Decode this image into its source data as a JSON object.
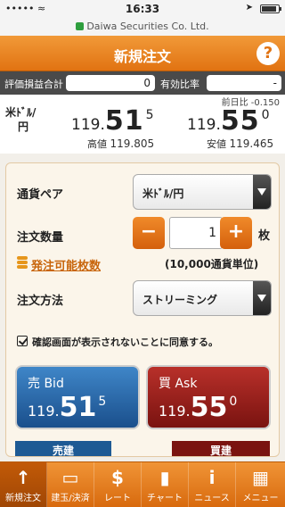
{
  "status": {
    "time": "16:33",
    "signal": "••••• ≈"
  },
  "url": {
    "text": "Daiwa Securities Co. Ltd."
  },
  "header": {
    "title": "新規注文",
    "help": "?"
  },
  "summary": {
    "pl_label": "評価損益合計",
    "pl_value": "0",
    "ratio_label": "有効比率",
    "ratio_value": "-"
  },
  "quote": {
    "pair_line1": "米ﾄﾞﾙ/",
    "pair_line2": "円",
    "cmp": "前日比 -0.150",
    "bid": {
      "pre": "119.",
      "big": "51",
      "pip": "5"
    },
    "ask": {
      "pre": "119.",
      "big": "55",
      "pip": "0"
    },
    "high_label": "高値",
    "high_value": "119.805",
    "low_label": "安値",
    "low_value": "119.465"
  },
  "form": {
    "pair_label": "通貨ペア",
    "pair_value": "米ﾄﾞﾙ/円",
    "qty_label": "注文数量",
    "qty_minus": "−",
    "qty_value": "1",
    "qty_plus": "+",
    "qty_unit": "枚",
    "available_link": "発注可能枚数",
    "unit_note": "(10,000通貨単位)",
    "method_label": "注文方法",
    "method_value": "ストリーミング",
    "agree_text": "確認画面が表示されないことに同意する。"
  },
  "trade": {
    "bid_title": "売 Bid",
    "bid_pre": "119.",
    "bid_big": "51",
    "bid_pip": "5",
    "ask_title": "買 Ask",
    "ask_pre": "119.",
    "ask_big": "55",
    "ask_pip": "0",
    "sell_label": "売建",
    "buy_label": "買建"
  },
  "tabs": [
    {
      "label": "新規注文",
      "icon": "↑"
    },
    {
      "label": "建玉/決済",
      "icon": "▭"
    },
    {
      "label": "レート",
      "icon": "$"
    },
    {
      "label": "チャート",
      "icon": "▮"
    },
    {
      "label": "ニュース",
      "icon": "i"
    },
    {
      "label": "メニュー",
      "icon": "▦"
    }
  ],
  "colors": {
    "accent": "#e17312",
    "bid": "#1a4f8c",
    "ask": "#7a1310"
  }
}
